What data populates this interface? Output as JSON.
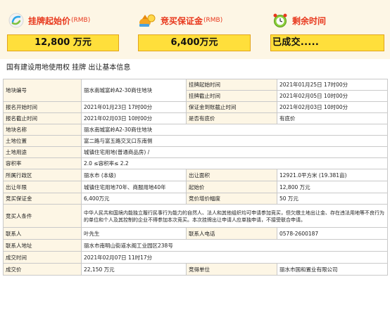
{
  "header": {
    "start_price": {
      "label": "挂牌起始价",
      "sub": "(RMB)",
      "value": "12,800 万元"
    },
    "deposit": {
      "label": "竞买保证金",
      "sub": "(RMB)",
      "value": "6,400万元"
    },
    "remaining": {
      "label": "剩余时间",
      "value": "已成交....."
    }
  },
  "section_title": "国有建设用地使用权 挂牌 出让基本信息",
  "table": {
    "parcel_no": {
      "label": "地块编号",
      "value": "丽水南城富岭A2-30商住地块"
    },
    "listing_start": {
      "label": "挂牌起始时间",
      "value": "2021年01月25日 17时00分"
    },
    "listing_end": {
      "label": "挂牌截止时间",
      "value": "2021年02月05日 10时00分"
    },
    "reg_start": {
      "label": "报名开始时间",
      "value": "2021年01月23日 17时00分"
    },
    "deposit_deadline": {
      "label": "保证金到账截止时间",
      "value": "2021年02月03日 10时00分"
    },
    "reg_end": {
      "label": "报名截止时间",
      "value": "2021年02月03日 10时00分"
    },
    "reserve": {
      "label": "是否有底价",
      "value": "有底价"
    },
    "parcel_name": {
      "label": "地块名称",
      "value": "丽水南城富岭A2-30商住地块"
    },
    "location": {
      "label": "土地位置",
      "value": "富二路与富五路交叉口东南侧"
    },
    "usage": {
      "label": "土地用途",
      "value": "城镇住宅用地(普通商品房) /"
    },
    "far": {
      "label": "容积率",
      "value": "2.0 ≤容积率≤ 2.2"
    },
    "district": {
      "label": "所属行政区",
      "value": "丽水市 (本级)"
    },
    "area": {
      "label": "出让面积",
      "value": "12921.0平方米 (19.381亩)"
    },
    "term": {
      "label": "出让年限",
      "value": "城镇住宅用地70年、商服用地40年"
    },
    "start_price": {
      "label": "起始价",
      "value": "12,800 万元"
    },
    "deposit": {
      "label": "竞买保证金",
      "value": "6,400万元"
    },
    "increment": {
      "label": "竞价增价幅度",
      "value": "50 万元"
    },
    "conditions": {
      "label": "竞买人条件",
      "value": "中华人民共和国境内能独立履行民事行为能力的自然人、法人和其他组织均可申请参加竞买，但欠缴土地出让金、存在违法用地等不良行为的单位和个人及其控制的企业不得参加本次竞买。本次挂牌出让申请人应单独申请，不接受联合申请。"
    },
    "contact": {
      "label": "联系人",
      "value": "叶先生"
    },
    "phone": {
      "label": "联系人电话",
      "value": "0578-2600187"
    },
    "address": {
      "label": "联系人地址",
      "value": "丽水市南明山街道水阁工业园区238号"
    },
    "deal_time": {
      "label": "成交时间",
      "value": "2021年02月07日 11时17分"
    },
    "deal_price": {
      "label": "成交价",
      "value": "22,150 万元"
    },
    "winner": {
      "label": "竞得单位",
      "value": "丽水市国和置业有限公司"
    }
  },
  "colors": {
    "accent_red": "#e8381d",
    "box_yellow": "#ffdf3b",
    "panel_bg": "#fdf6e5"
  }
}
